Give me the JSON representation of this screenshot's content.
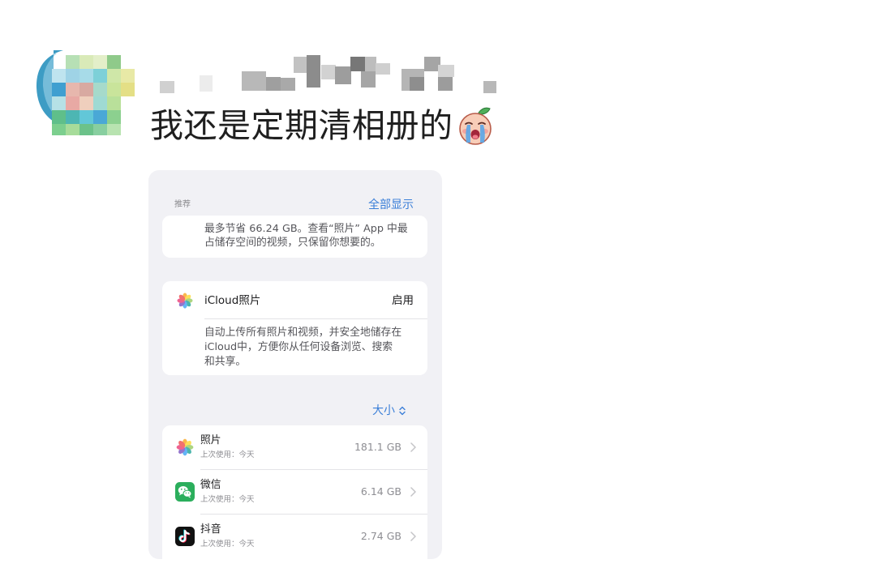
{
  "post": {
    "comment": "我还是定期清相册的",
    "emoji_icon": "crying-face-emoji"
  },
  "storage_screenshot": {
    "recommendations": {
      "section_label": "推荐",
      "show_all_label": "全部显示",
      "tip_lines": [
        "最多节省 66.24 GB。查看“照片” App 中最",
        "占储存空间的视频，只保留你想要的。"
      ]
    },
    "icloud_photos": {
      "icon": "photos-app-icon",
      "title": "iCloud照片",
      "action_label": "启用",
      "description_lines": [
        "自动上传所有照片和视频，并安全地储存在",
        "iCloud中，方便你从任何设备浏览、搜索",
        "和共享。"
      ]
    },
    "sort": {
      "label": "大小",
      "icon": "chevron-up-down-icon"
    },
    "apps": [
      {
        "icon": "photos-app-icon",
        "name": "照片",
        "last_used": "上次使用：今天",
        "size": "181.1 GB"
      },
      {
        "icon": "wechat-app-icon",
        "name": "微信",
        "last_used": "上次使用：今天",
        "size": "6.14 GB"
      },
      {
        "icon": "douyin-app-icon",
        "name": "抖音",
        "last_used": "上次使用：今天",
        "size": "2.74 GB"
      }
    ]
  },
  "colors": {
    "ios_blue": "#3b7fd8",
    "grouped_background": "#f1f1f5",
    "wechat_green": "#2bae5c",
    "douyin_black": "#111111"
  }
}
